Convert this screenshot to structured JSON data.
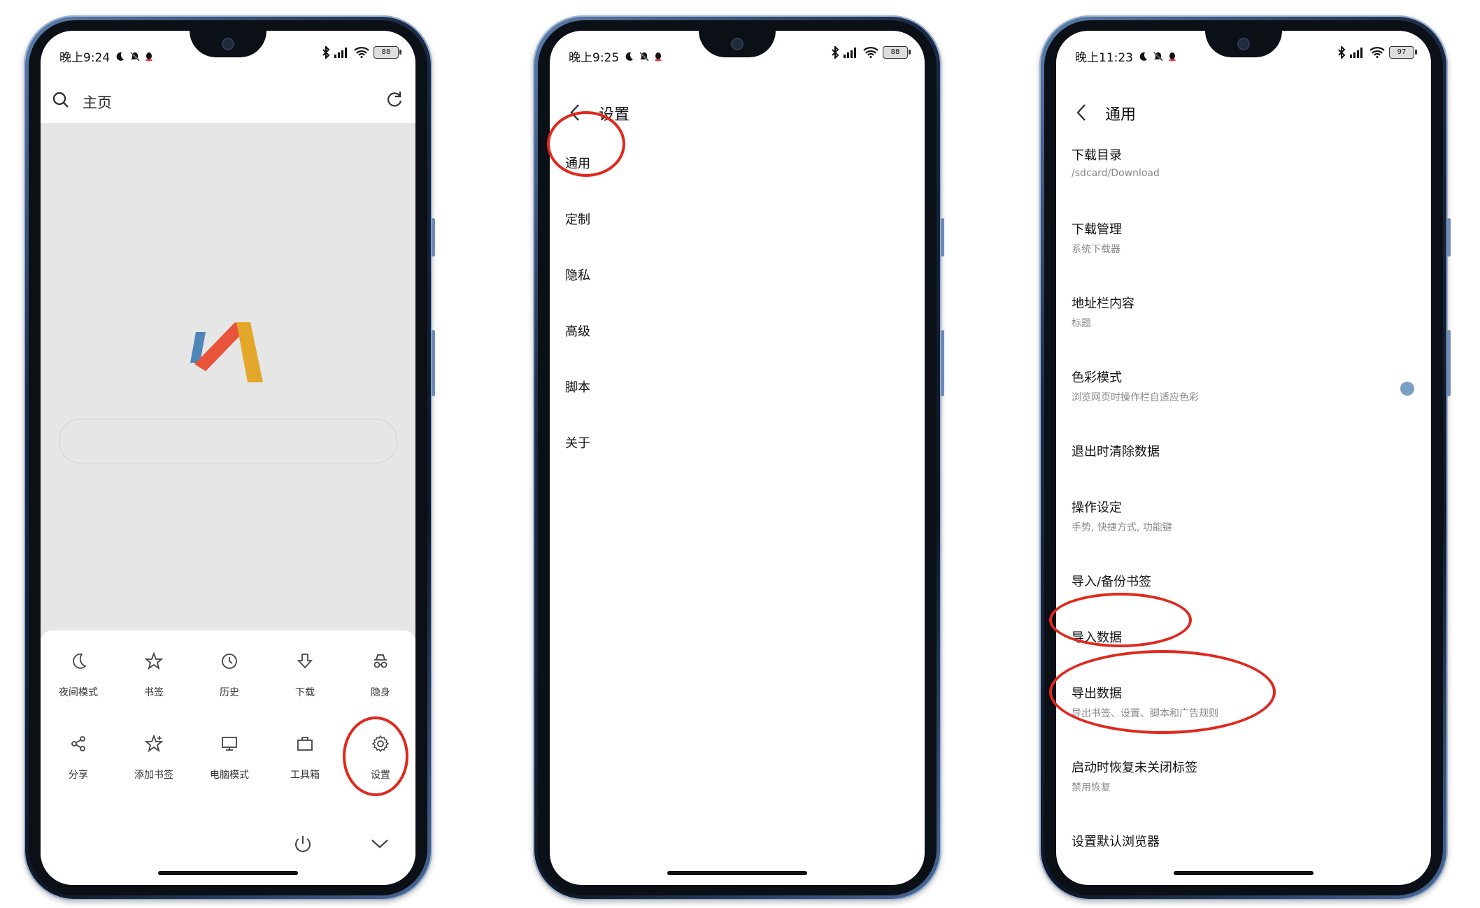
{
  "phones": [
    {
      "status": {
        "time": "晚上9:24",
        "battery": "88"
      },
      "topbar": {
        "title": "主页"
      },
      "menu": {
        "items": [
          {
            "icon": "moon-icon",
            "label": "夜间模式"
          },
          {
            "icon": "star-icon",
            "label": "书签"
          },
          {
            "icon": "clock-icon",
            "label": "历史"
          },
          {
            "icon": "download-icon",
            "label": "下载"
          },
          {
            "icon": "incognito-icon",
            "label": "隐身"
          },
          {
            "icon": "share-icon",
            "label": "分享"
          },
          {
            "icon": "star-add-icon",
            "label": "添加书签"
          },
          {
            "icon": "monitor-icon",
            "label": "电脑模式"
          },
          {
            "icon": "toolbox-icon",
            "label": "工具箱"
          },
          {
            "icon": "gear-icon",
            "label": "设置"
          }
        ]
      }
    },
    {
      "status": {
        "time": "晚上9:25",
        "battery": "88"
      },
      "header": {
        "title": "设置"
      },
      "items": [
        "通用",
        "定制",
        "隐私",
        "高级",
        "脚本",
        "关于"
      ]
    },
    {
      "status": {
        "time": "晚上11:23",
        "battery": "97"
      },
      "header": {
        "title": "通用"
      },
      "items": [
        {
          "title": "下载目录",
          "sub": "/sdcard/Download"
        },
        {
          "title": "下载管理",
          "sub": "系统下载器"
        },
        {
          "title": "地址栏内容",
          "sub": "标题"
        },
        {
          "title": "色彩模式",
          "sub": "浏览网页时操作栏自适应色彩"
        },
        {
          "title": "退出时清除数据",
          "sub": ""
        },
        {
          "title": "操作设定",
          "sub": "手势, 快捷方式, 功能键"
        },
        {
          "title": "导入/备份书签",
          "sub": ""
        },
        {
          "title": "导入数据",
          "sub": ""
        },
        {
          "title": "导出数据",
          "sub": "导出书签、设置、脚本和广告规则"
        },
        {
          "title": "启动时恢复未关闭标签",
          "sub": "禁用恢复"
        },
        {
          "title": "设置默认浏览器",
          "sub": ""
        }
      ]
    }
  ],
  "colors": {
    "highlight": "#e0281c",
    "toggle": "#7a9fc4",
    "logo_red": "#e8533a",
    "logo_yellow": "#e3a82a",
    "logo_blue": "#4f86b8"
  }
}
